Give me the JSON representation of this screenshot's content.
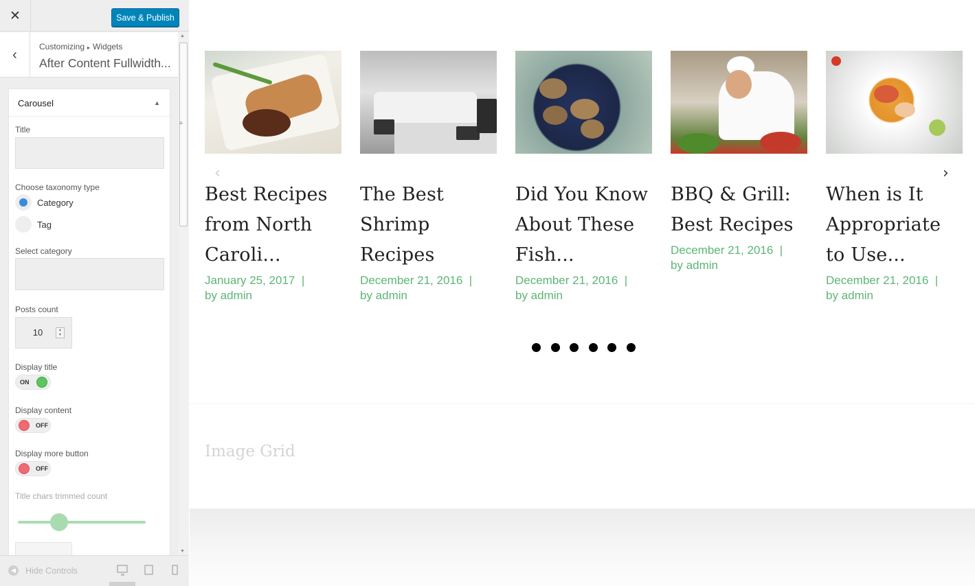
{
  "topbar": {
    "close_glyph": "✕",
    "publish_label": "Save & Publish"
  },
  "panel": {
    "back_glyph": "‹",
    "breadcrumb_root": "Customizing",
    "breadcrumb_sep": "▸",
    "breadcrumb_section": "Widgets",
    "title": "After Content Fullwidth..."
  },
  "widget": {
    "name": "Carousel",
    "toggle_glyph": "▲",
    "title_label": "Title",
    "title_value": "",
    "taxonomy_label": "Choose taxonomy type",
    "taxonomy_options": [
      "Category",
      "Tag"
    ],
    "taxonomy_selected": "Category",
    "category_label": "Select category",
    "category_value": "",
    "posts_count_label": "Posts count",
    "posts_count": "10",
    "display_title_label": "Display title",
    "display_title_state": "ON",
    "display_content_label": "Display content",
    "display_content_state": "OFF",
    "display_more_label": "Display more button",
    "display_more_state": "OFF",
    "trim_label": "Title chars trimmed count"
  },
  "scrollbar": {
    "up": "▲",
    "down": "▼",
    "grip": "≡"
  },
  "footer": {
    "hide_label": "Hide Controls",
    "hide_glyph": "◀"
  },
  "carousel": {
    "prev_glyph": "‹",
    "next_glyph": "›",
    "posts": [
      {
        "title": "Best Recipes from North Caroli...",
        "date": "January 25, 2017",
        "author": "by admin",
        "image": "grilled-fish-plate"
      },
      {
        "title": "The Best Shrimp Recipes",
        "date": "December 21, 2016",
        "author": "by admin",
        "image": "restaurant-tables"
      },
      {
        "title": "Did You Know About These Fish...",
        "date": "December 21, 2016",
        "author": "by admin",
        "image": "cast-iron-pan"
      },
      {
        "title": "BBQ & Grill: Best Recipes",
        "date": "December 21, 2016",
        "author": "by admin",
        "image": "chef-with-vegetables"
      },
      {
        "title": "When is It Appropriate to Use...",
        "date": "December 21, 2016",
        "author": "by admin",
        "image": "seafood-soup-bowl"
      }
    ],
    "dot_count": 6,
    "meta_color": "#5cb574"
  },
  "next_section_title": "Image Grid"
}
